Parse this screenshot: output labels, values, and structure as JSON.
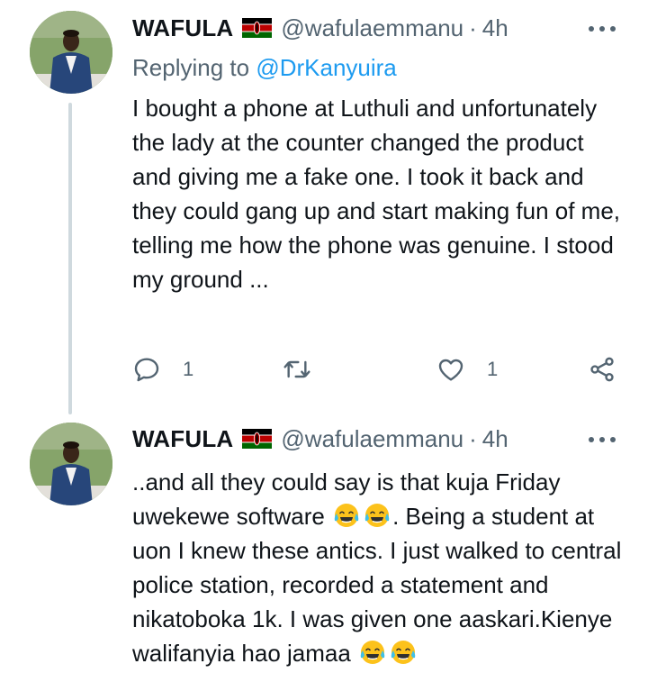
{
  "tweets": [
    {
      "author_name": "WAFULA",
      "handle": "@wafulaemmanu",
      "separator": "·",
      "time": "4h",
      "replying_prefix": "Replying to",
      "replying_mention": "@DrKanyuira",
      "body": "I bought a phone at Luthuli and unfortunately the lady at the counter changed the product and giving me a fake one. I took it back and they could gang up and start making fun of me, telling me how the phone was genuine. I stood my ground ...",
      "reply_count": "1",
      "retweet_count": "",
      "like_count": "1",
      "icons": [
        "reply-icon",
        "retweet-icon",
        "like-icon",
        "share-icon",
        "more-icon",
        "kenya-flag-icon"
      ]
    },
    {
      "author_name": "WAFULA",
      "handle": "@wafulaemmanu",
      "separator": "·",
      "time": "4h",
      "body_part1": "..and all they could say is that kuja Friday uwekewe software ",
      "body_part2": ". Being a student at uon I knew these antics. I just walked to central police station, recorded a statement and nikatoboka 1k. I was given one aaskari.Kienye walifanyia hao jamaa ",
      "emoji": "face-with-tears-of-joy"
    }
  ],
  "colors": {
    "text_primary": "#0f1419",
    "text_secondary": "#536471",
    "link": "#1d9bf0",
    "thread_line": "#cfd9de"
  }
}
